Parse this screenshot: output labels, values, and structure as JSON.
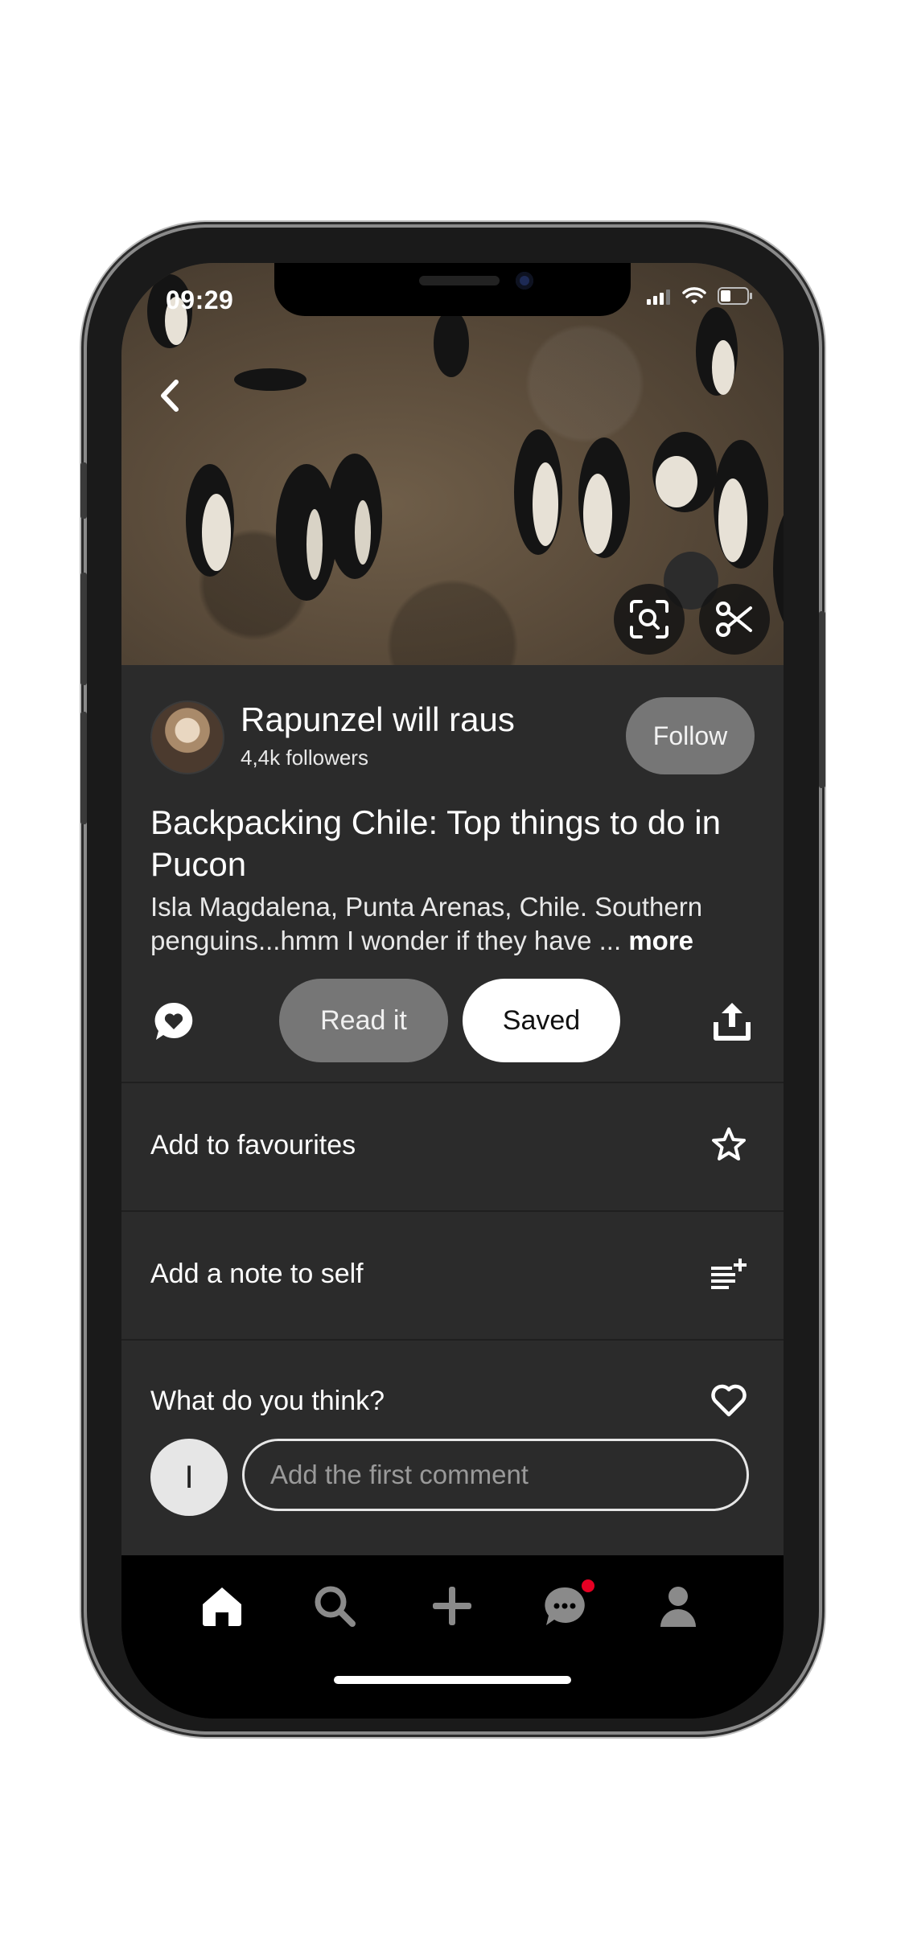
{
  "status_bar": {
    "time": "09:29"
  },
  "icons": {
    "back": "chevron-left-icon",
    "visual_search": "visual-search-icon",
    "scissors": "scissors-icon",
    "comment": "comment-bubble-icon",
    "share": "share-icon",
    "favourite": "star-icon",
    "note": "note-add-icon",
    "react": "heart-icon",
    "nav_home": "home-icon",
    "nav_search": "search-icon",
    "nav_create": "plus-icon",
    "nav_messages": "messages-icon",
    "nav_profile": "profile-icon"
  },
  "author": {
    "name": "Rapunzel will raus",
    "followers": "4,4k followers",
    "follow_label": "Follow"
  },
  "pin": {
    "title": "Backpacking Chile: Top things to do in Pucon",
    "description": "Isla Magdalena, Punta Arenas, Chile. Southern penguins...hmm I wonder if they have ...",
    "more_label": "more"
  },
  "actions": {
    "read_label": "Read it",
    "saved_label": "Saved"
  },
  "menu": {
    "favourites": "Add to favourites",
    "note": "Add a note to self",
    "reaction": "What do you think?"
  },
  "comment": {
    "avatar_initial": "I",
    "placeholder": "Add the first comment"
  },
  "colors": {
    "accent_red": "#e60023",
    "panel": "#2b2b2b",
    "pill_gray": "#767676"
  }
}
